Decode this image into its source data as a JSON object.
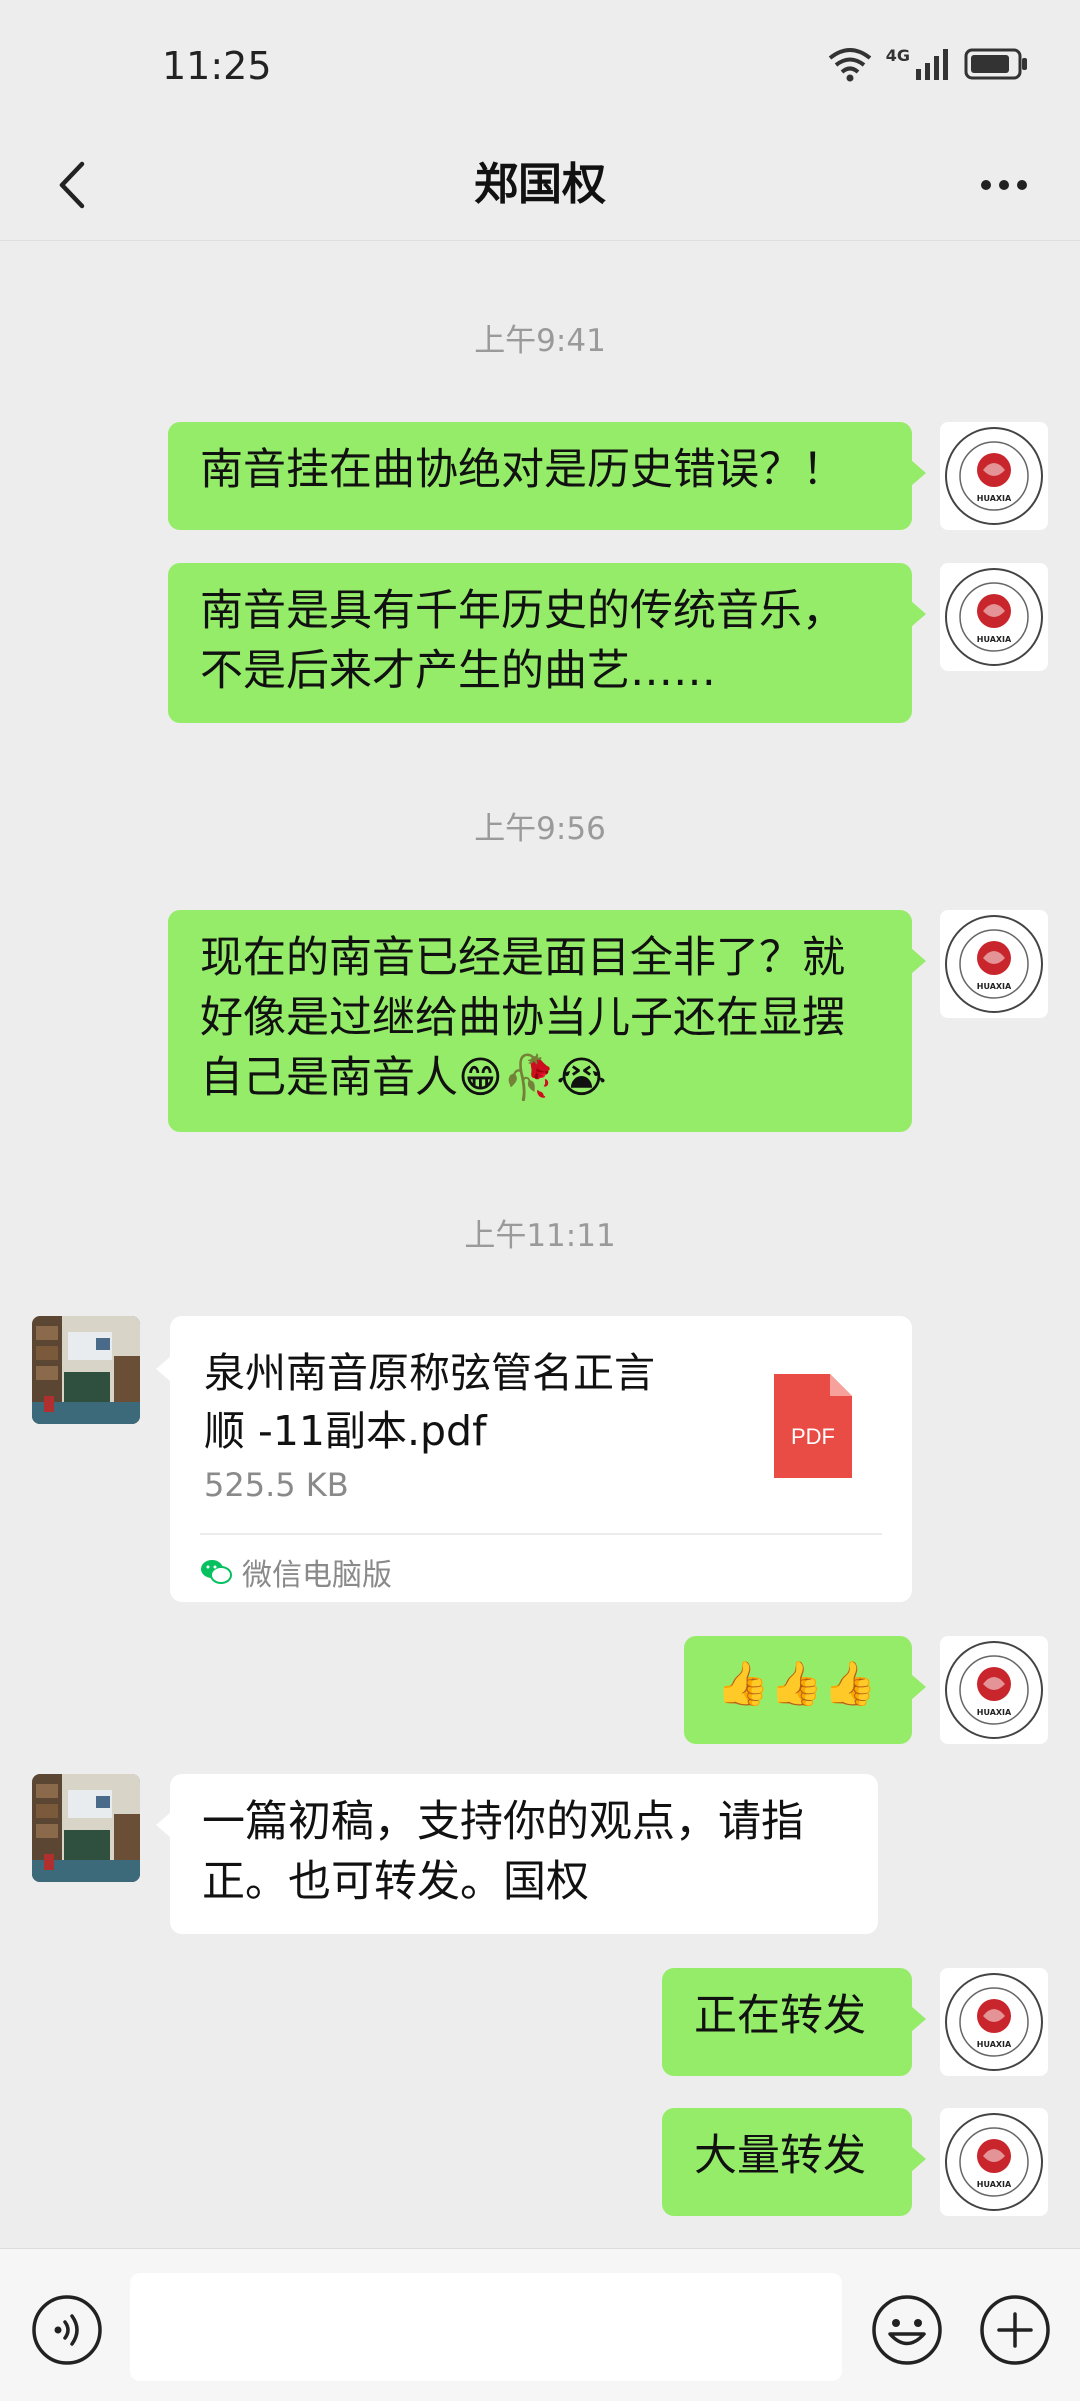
{
  "status": {
    "time": "11:25",
    "network": "4G"
  },
  "header": {
    "title": "郑国权"
  },
  "brand": {
    "green_bubble": "#95ec69",
    "pdf_red": "#e94b45",
    "wechat_green": "#07c160"
  },
  "avatar_logo_text": "HUAXIA",
  "timestamps": [
    "上午9:41",
    "上午9:56",
    "上午11:11"
  ],
  "messages": [
    {
      "text": "南音挂在曲协绝对是历史错误？！"
    },
    {
      "lines": [
        "南音是具有千年历史的传统音乐，",
        "不是后来才产生的曲艺……"
      ]
    },
    {
      "lines": [
        "现在的南音已经是面目全非了？就",
        "好像是过继给曲协当儿子还在显摆",
        "自己是南音人😁🥀😭"
      ]
    },
    {
      "text": "👍👍👍"
    },
    {
      "lines": [
        "一篇初稿，支持你的观点，请指",
        "正。也可转发。国权"
      ]
    },
    {
      "text": "正在转发"
    },
    {
      "text": "大量转发"
    }
  ],
  "file": {
    "name_lines": [
      "泉州南音原称弦管名正言",
      "顺 -11副本.pdf"
    ],
    "size": "525.5 KB",
    "type_label": "PDF",
    "source": "微信电脑版"
  },
  "input": {
    "placeholder": ""
  }
}
